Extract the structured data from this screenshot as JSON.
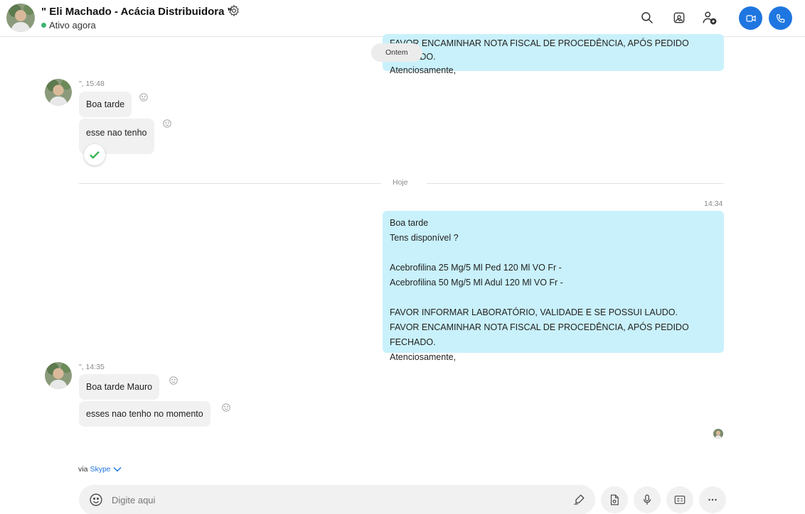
{
  "header": {
    "contact_name": "\" Eli Machado - Acácia Distribuidora \"",
    "status": "Ativo agora",
    "icons": [
      "search-icon",
      "gallery-icon",
      "add-people-icon",
      "video-call-icon",
      "audio-call-icon"
    ]
  },
  "colors": {
    "accent": "#1f76e0",
    "outgoing_bubble": "#c9f1fb",
    "incoming_bubble": "#f1f1f1",
    "online": "#3cb371"
  },
  "chat": {
    "pinned_date": "Ontem",
    "prev_message_tail": [
      "FAVOR ENCAMINHAR NOTA FISCAL DE PROCEDÊNCIA, APÓS PEDIDO FECHADO.",
      "Atenciosamente,"
    ],
    "group1": {
      "meta": "\", 15:48",
      "messages": [
        "Boa tarde",
        "esse nao tenho"
      ]
    },
    "divider_label": "Hoje",
    "outgoing": {
      "time": "14:34",
      "lines": [
        "Boa tarde",
        "Tens disponível ?",
        "",
        "Acebrofilina 25 Mg/5 Ml Ped 120 Ml VO Fr -",
        "Acebrofilina 50 Mg/5 Ml Adul 120 Ml VO Fr -",
        "",
        "FAVOR INFORMAR LABORATÓRIO, VALIDADE E SE POSSUI LAUDO.",
        "FAVOR ENCAMINHAR NOTA FISCAL DE PROCEDÊNCIA, APÓS PEDIDO FECHADO.",
        "Atenciosamente,"
      ]
    },
    "group2": {
      "meta": "\", 14:35",
      "messages": [
        "Boa tarde Mauro",
        "esses nao tenho no momento"
      ]
    }
  },
  "footer": {
    "via_label": "via",
    "via_source": "Skype",
    "input_placeholder": "Digite aqui"
  }
}
